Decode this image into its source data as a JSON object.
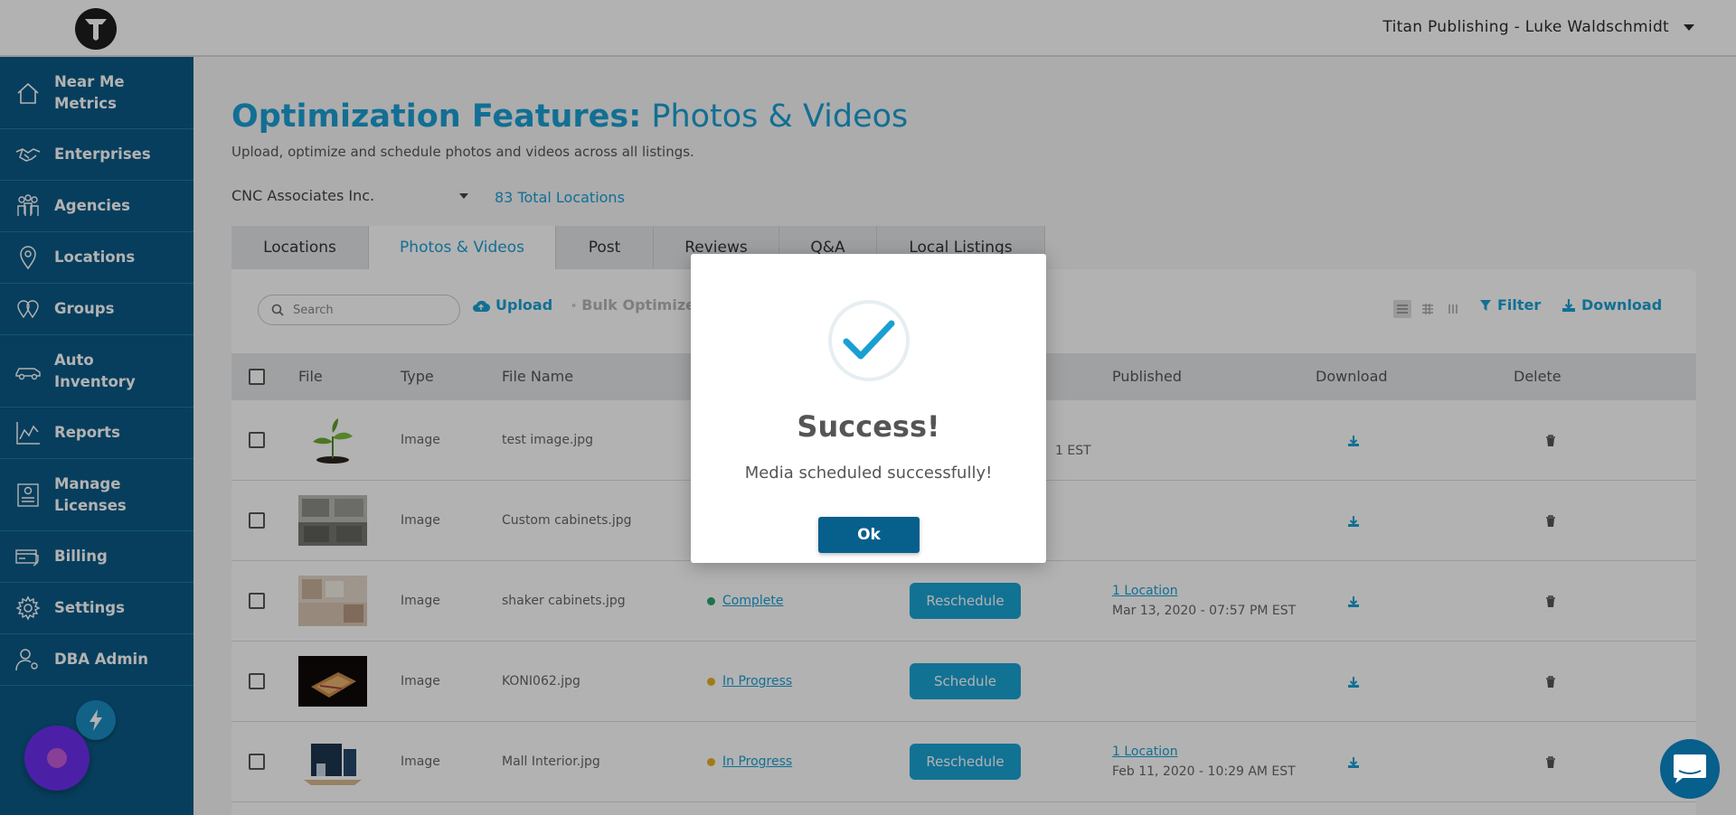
{
  "header": {
    "user_label": "Titan Publishing - Luke Waldschmidt"
  },
  "sidebar": {
    "items": [
      {
        "label_line1": "Near Me",
        "label_line2": "Metrics",
        "icon": "home-icon"
      },
      {
        "label_line1": "Enterprises",
        "label_line2": "",
        "icon": "handshake-icon"
      },
      {
        "label_line1": "Agencies",
        "label_line2": "",
        "icon": "people-icon"
      },
      {
        "label_line1": "Locations",
        "label_line2": "",
        "icon": "map-pin-icon"
      },
      {
        "label_line1": "Groups",
        "label_line2": "",
        "icon": "multi-pin-icon"
      },
      {
        "label_line1": "Auto",
        "label_line2": "Inventory",
        "icon": "car-icon"
      },
      {
        "label_line1": "Reports",
        "label_line2": "",
        "icon": "chart-icon"
      },
      {
        "label_line1": "Manage",
        "label_line2": "Licenses",
        "icon": "license-icon"
      },
      {
        "label_line1": "Billing",
        "label_line2": "",
        "icon": "billing-icon"
      },
      {
        "label_line1": "Settings",
        "label_line2": "",
        "icon": "gear-icon"
      },
      {
        "label_line1": "DBA Admin",
        "label_line2": "",
        "icon": "admin-user-icon"
      }
    ]
  },
  "page": {
    "title_bold": "Optimization Features:",
    "title_light": "Photos & Videos",
    "subtitle": "Upload, optimize and schedule photos and videos across all listings.",
    "account": "CNC Associates Inc.",
    "total_locations": "83 Total Locations"
  },
  "tabs": [
    "Locations",
    "Photos & Videos",
    "Post",
    "Reviews",
    "Q&A",
    "Local Listings"
  ],
  "toolbar": {
    "search_placeholder": "Search",
    "upload_label": "Upload",
    "bulk_label": "Bulk Optimize",
    "filter_label": "Filter",
    "download_label": "Download"
  },
  "table": {
    "headers": {
      "file": "File",
      "type": "Type",
      "file_name": "File Name",
      "published": "Published",
      "download": "Download",
      "delete": "Delete"
    },
    "rows": [
      {
        "type": "Image",
        "file_name": "test image.jpg",
        "status": "",
        "action": "",
        "pub_loc": "",
        "pub_date": "",
        "partial_date": "1 EST"
      },
      {
        "type": "Image",
        "file_name": "Custom cabinets.jpg",
        "status": "",
        "action": "",
        "pub_loc": "",
        "pub_date": "",
        "partial_date": ""
      },
      {
        "type": "Image",
        "file_name": "shaker cabinets.jpg",
        "status": "Complete",
        "action": "Reschedule",
        "pub_loc": "1 Location",
        "pub_date": "Mar 13, 2020 - 07:57 PM EST",
        "partial_date": ""
      },
      {
        "type": "Image",
        "file_name": "KONI062.jpg",
        "status": "In Progress",
        "action": "Schedule",
        "pub_loc": "",
        "pub_date": "",
        "partial_date": ""
      },
      {
        "type": "Image",
        "file_name": "Mall Interior.jpg",
        "status": "In Progress",
        "action": "Reschedule",
        "pub_loc": "1 Location",
        "pub_date": "Feb 11, 2020 - 10:29 AM EST",
        "partial_date": ""
      }
    ]
  },
  "modal": {
    "title": "Success!",
    "message": "Media scheduled successfully!",
    "ok_label": "Ok"
  },
  "colors": {
    "brand": "#1a9fd3",
    "sidebar": "#0b5a86",
    "complete": "#2aa56f",
    "in_progress": "#e8b020"
  }
}
